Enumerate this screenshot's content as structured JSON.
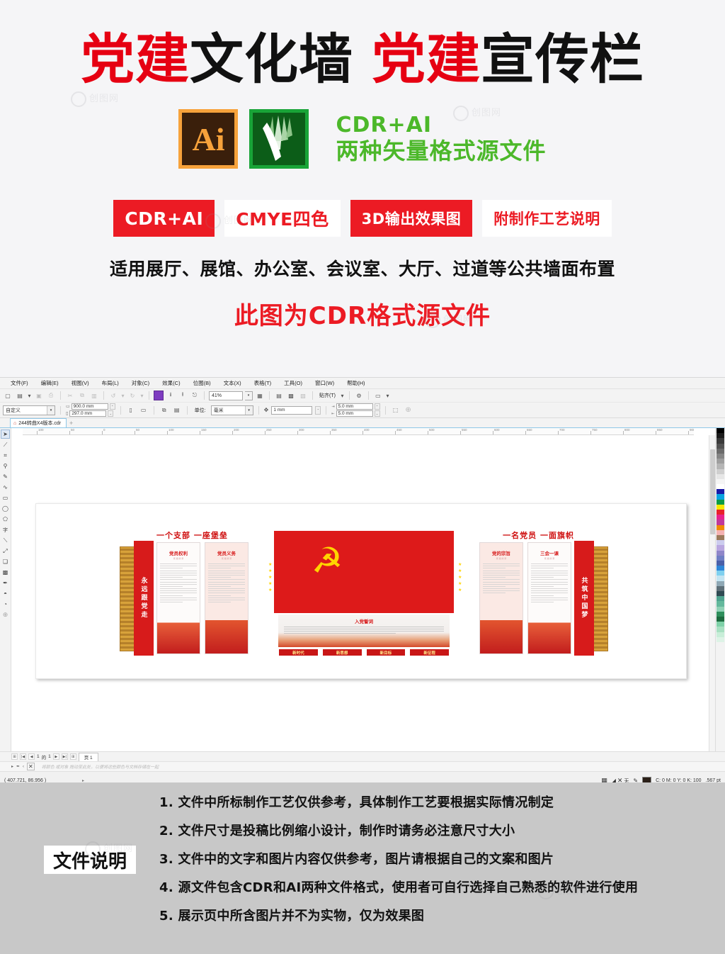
{
  "promo": {
    "title_parts": [
      {
        "text": "党建",
        "color": "red"
      },
      {
        "text": "文化墙",
        "color": "black"
      },
      {
        "text": "党建",
        "color": "red"
      },
      {
        "text": "宣传栏",
        "color": "black"
      }
    ],
    "ai_icon_glyph": "Ai",
    "format_line1": "CDR+AI",
    "format_line2": "两种矢量格式源文件",
    "badges": [
      {
        "label": "CDR+AI",
        "style": "solid"
      },
      {
        "label": "CMYE四色",
        "style": "ghost"
      },
      {
        "label": "3D输出效果图",
        "style": "solid"
      },
      {
        "label": "附制作工艺说明",
        "style": "ghost"
      }
    ],
    "applies_to": "适用展厅、展馆、办公室、会议室、大厅、过道等公共墙面布置",
    "format_note": "此图为CDR格式源文件",
    "watermark": "创图网",
    "colors": {
      "red": "#e60012",
      "badge_red": "#ec1b24",
      "green": "#4cb82a",
      "ai_orange": "#f7a23b",
      "cdr_green": "#19a438"
    }
  },
  "app": {
    "menus": [
      "文件(F)",
      "编辑(E)",
      "视图(V)",
      "布局(L)",
      "对象(C)",
      "效果(C)",
      "位图(B)",
      "文本(X)",
      "表格(T)",
      "工具(O)",
      "窗口(W)",
      "帮助(H)"
    ],
    "toolbar": {
      "zoom_level": "41%",
      "snap_label": "贴齐(T)"
    },
    "property_bar": {
      "paper_preset": "自定义",
      "page_width": "900.0 mm",
      "page_height": "297.0 mm",
      "units_label": "单位:",
      "units_value": "毫米",
      "nudge": "1 mm",
      "duplicate_x": "5.0 mm",
      "duplicate_y": "5.0 mm"
    },
    "document_tab": "244转曲X4版本.cdr",
    "new_tab_glyph": "+",
    "ruler_labels": [
      "100",
      "50",
      "0",
      "50",
      "100",
      "150",
      "200",
      "250",
      "300",
      "350",
      "400",
      "450",
      "500",
      "550",
      "600",
      "650",
      "700",
      "750",
      "800",
      "850",
      "900",
      "1000"
    ],
    "page_nav": {
      "current": "1",
      "of_label": "的",
      "total": "1",
      "page_tab": "页 1"
    },
    "palette_hint": "将颜色 或对象 拖动至此处，以便将这些颜色与文档存储在一起",
    "status": {
      "coordinates": "( 407.721, 86.956 )",
      "fill_none": "无",
      "outline_color": "C: 0 M: 0 Y: 0 K: 100",
      "outline_width": ".567 pt"
    },
    "tools": [
      "pick-tool",
      "shape-tool",
      "crop-tool",
      "zoom-tool",
      "freehand-tool",
      "artistic-media-tool",
      "rectangle-tool",
      "ellipse-tool",
      "polygon-tool",
      "text-tool",
      "dimension-tool",
      "connector-tool",
      "drop-shadow-tool",
      "transparency-tool",
      "color-eyedropper-tool",
      "fill-tool",
      "outline-tool",
      "quick-customize"
    ],
    "palette_colors": [
      "#000000",
      "#1c1c1c",
      "#333333",
      "#4a4a4a",
      "#616161",
      "#787878",
      "#8f8f8f",
      "#a6a6a6",
      "#bdbdbd",
      "#d4d4d4",
      "#ebebeb",
      "#ffffff",
      "#1a1aa8",
      "#0aa3e0",
      "#0a9b46",
      "#f5e800",
      "#e8222a",
      "#e8228c",
      "#c0399b",
      "#f08a00",
      "#f5b2b2",
      "#9c7a5c",
      "#ccccee",
      "#b9a7e0",
      "#8f86c9",
      "#6f7fc4",
      "#4a5fa8",
      "#2e86d8",
      "#7fd0ef",
      "#c2e4f2",
      "#8fa8b5",
      "#5d6f78",
      "#2f4a52",
      "#4fa38f",
      "#63b89c",
      "#8fd1b5",
      "#2f8f5c",
      "#1d6b3f",
      "#7fd1a8",
      "#a8e0c2",
      "#c8eed8",
      "#ddf3e6"
    ]
  },
  "artwork": {
    "headline_left": "一个支部 一座堡垒",
    "headline_right": "一名党员 一面旗帜",
    "vertical_left": "永远跟党走",
    "vertical_right": "共筑中国梦",
    "panels": [
      {
        "title": "党员权利",
        "subtitle": "党 章 摘 录"
      },
      {
        "title": "党员义务",
        "subtitle": "党 章 摘 录"
      },
      {
        "title": "党的宗旨",
        "subtitle": "党 章 摘 录"
      },
      {
        "title": "三会一课",
        "subtitle": "党 章 摘 录"
      }
    ],
    "oath_title": "入党誓词",
    "tags": [
      "新时代",
      "新思想",
      "新目标",
      "新征程"
    ],
    "emblem": "☭"
  },
  "footer": {
    "label": "文件说明",
    "notes": [
      "1. 文件中所标制作工艺仅供参考，具体制作工艺要根据实际情况制定",
      "2. 文件尺寸是投稿比例缩小设计，制作时请务必注意尺寸大小",
      "3. 文件中的文字和图片内容仅供参考，图片请根据自己的文案和图片",
      "4. 源文件包含CDR和AI两种文件格式，使用者可自行选择自己熟悉的软件进行使用",
      "5. 展示页中所含图片并不为实物，仅为效果图"
    ]
  }
}
